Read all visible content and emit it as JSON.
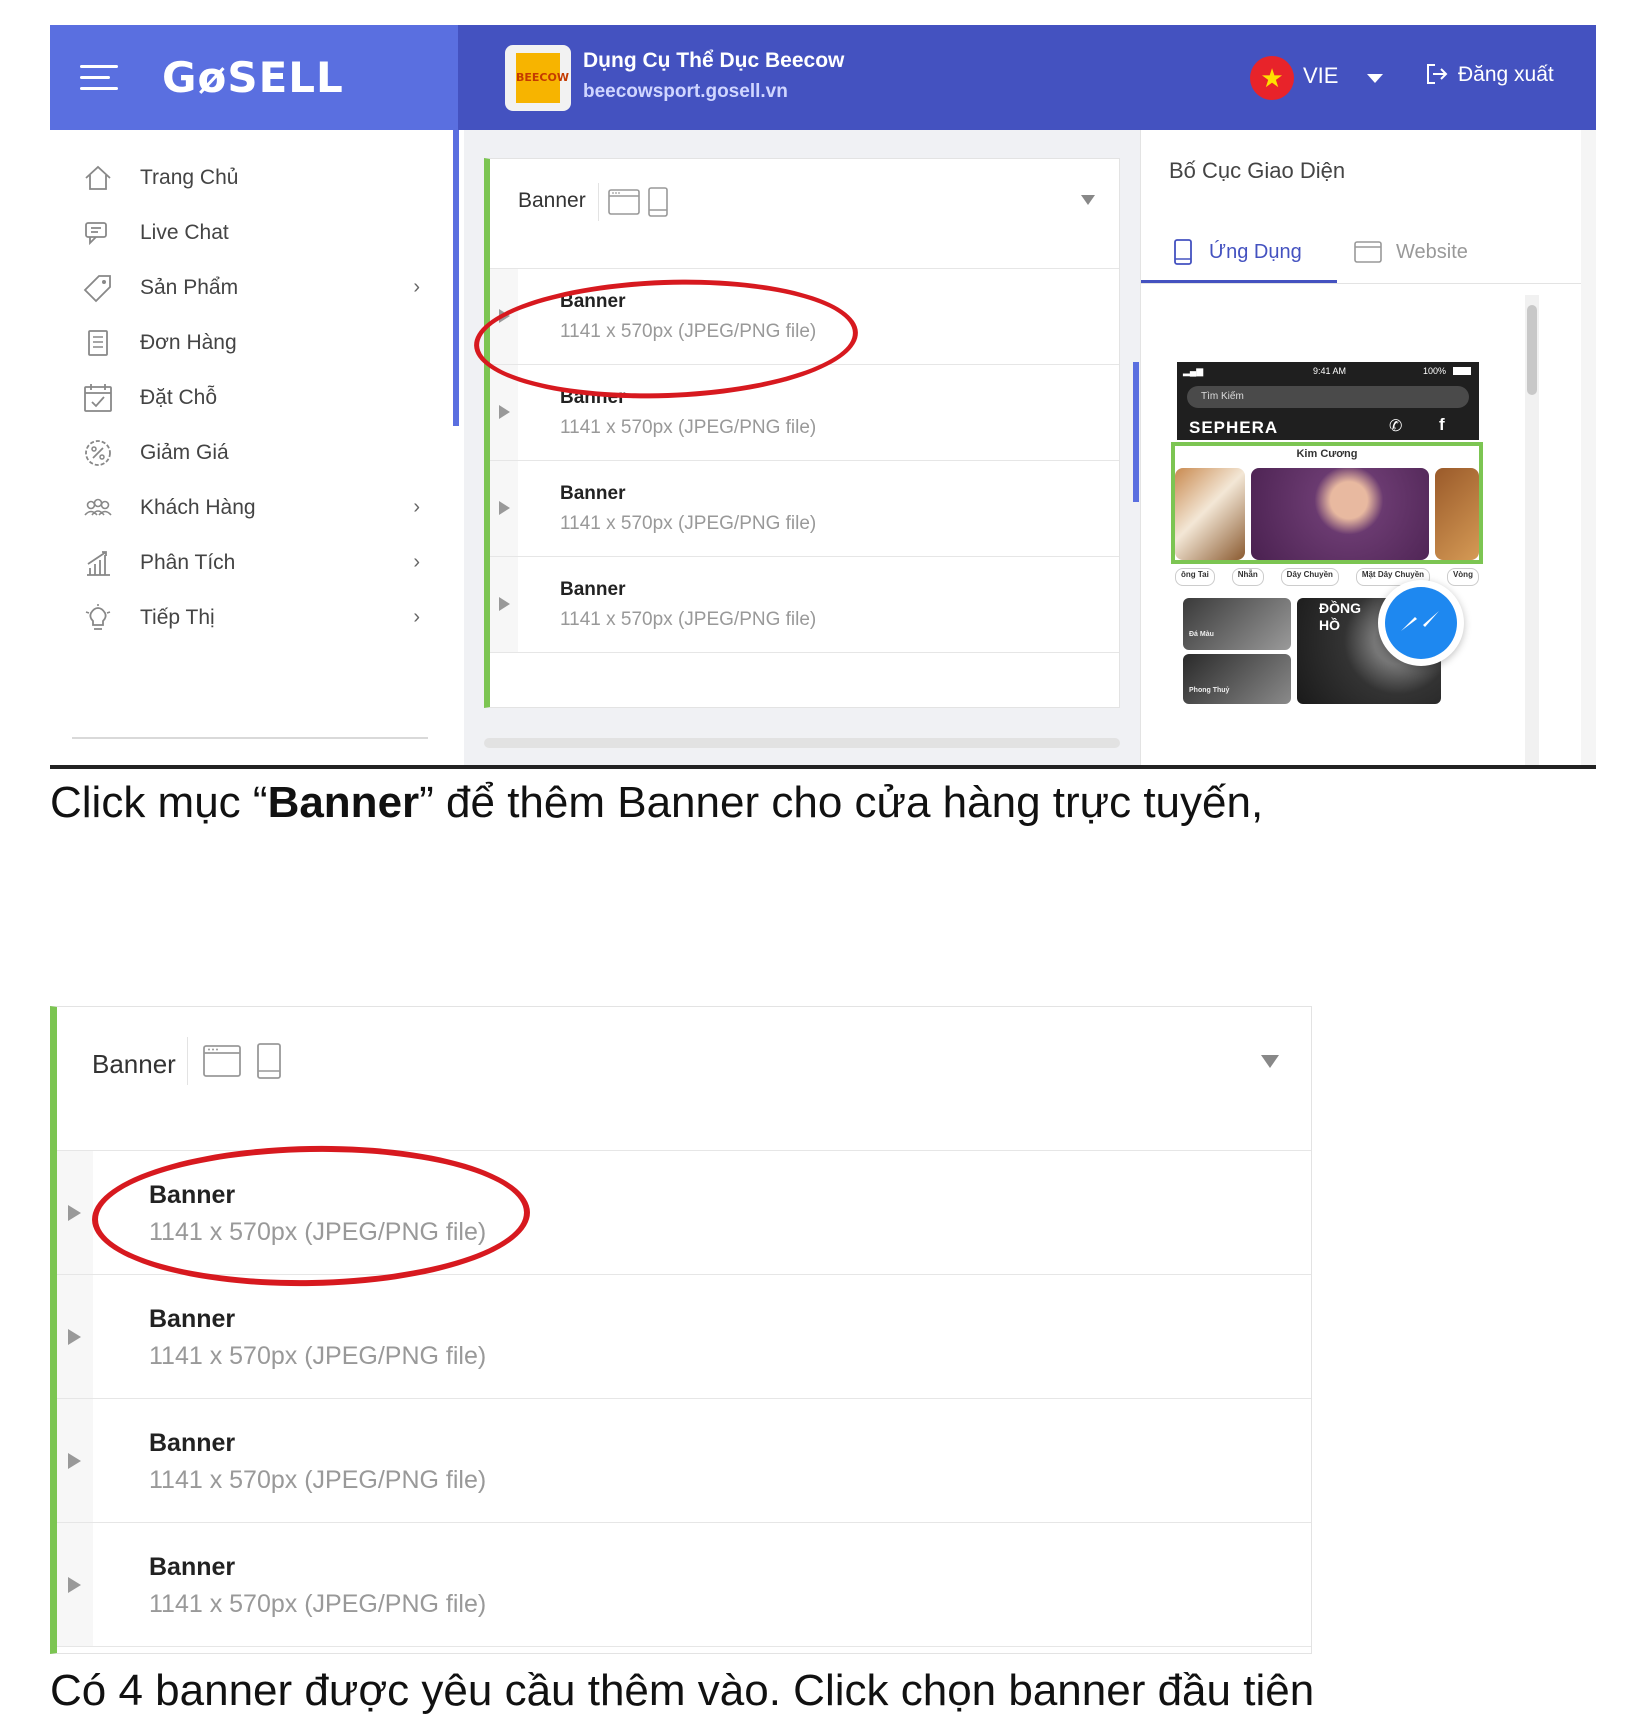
{
  "header": {
    "logo": "GøSELL",
    "store_name": "Dụng Cụ Thể Dục Beecow",
    "store_url": "beecowsport.gosell.vn",
    "store_logo_text": "BEECOW",
    "language": "VIE",
    "logout_label": "Đăng xuất"
  },
  "sidebar": {
    "items": [
      {
        "label": "Trang Chủ",
        "icon": "home-icon",
        "has_submenu": false
      },
      {
        "label": "Live Chat",
        "icon": "chat-icon",
        "has_submenu": false
      },
      {
        "label": "Sản Phẩm",
        "icon": "tag-icon",
        "has_submenu": true
      },
      {
        "label": "Đơn Hàng",
        "icon": "receipt-icon",
        "has_submenu": false
      },
      {
        "label": "Đặt Chỗ",
        "icon": "calendar-icon",
        "has_submenu": false
      },
      {
        "label": "Giảm Giá",
        "icon": "discount-icon",
        "has_submenu": false
      },
      {
        "label": "Khách Hàng",
        "icon": "customers-icon",
        "has_submenu": true
      },
      {
        "label": "Phân Tích",
        "icon": "chart-icon",
        "has_submenu": true
      },
      {
        "label": "Tiếp Thị",
        "icon": "lightbulb-icon",
        "has_submenu": true
      }
    ]
  },
  "editor": {
    "section_title": "Banner",
    "banners": [
      {
        "title": "Banner",
        "spec": "1141 x 570px (JPEG/PNG file)"
      },
      {
        "title": "Banner",
        "spec": "1141 x 570px (JPEG/PNG file)"
      },
      {
        "title": "Banner",
        "spec": "1141 x 570px (JPEG/PNG file)"
      },
      {
        "title": "Banner",
        "spec": "1141 x 570px (JPEG/PNG file)"
      }
    ]
  },
  "layout_panel": {
    "title": "Bố Cục Giao Diện",
    "tabs": [
      {
        "label": "Ứng Dụng",
        "active": true
      },
      {
        "label": "Website",
        "active": false
      }
    ]
  },
  "phone_preview": {
    "time": "9:41 AM",
    "battery": "100%",
    "search_placeholder": "Tìm Kiếm",
    "brand": "SEPHERA",
    "fb": "f",
    "banner_caption": "Kim Cương",
    "categories": [
      "ông Tai",
      "Nhẫn",
      "Dây Chuyền",
      "Mặt Dây Chuyền",
      "Vòng"
    ],
    "tile_dong_ho": "ĐỒNG HỒ",
    "tile_small_1": "Đá Màu",
    "tile_small_2": "Phong Thuỷ"
  },
  "captions": {
    "line1_pre": "Click mục “",
    "line1_bold": "Banner",
    "line1_post": "” để thêm Banner cho cửa hàng trực tuyến,",
    "line2": "Có 4 banner được yêu cầu thêm vào. Click chọn banner đầu tiên"
  },
  "colors": {
    "header_bg": "#4452c0",
    "header_left_bg": "#5a6fe0",
    "accent_green": "#7cc552",
    "highlight_red": "#d7191f",
    "messenger_blue": "#1e88f0"
  }
}
